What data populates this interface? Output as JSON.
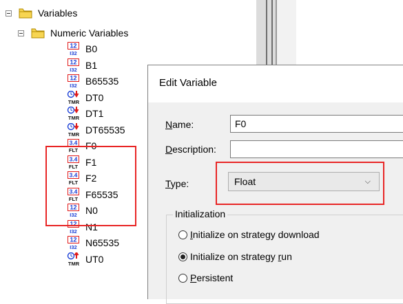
{
  "tree": {
    "root": "Variables",
    "numeric_folder": "Numeric Variables",
    "items": [
      {
        "name": "B0",
        "icon": "int32-icon"
      },
      {
        "name": "B1",
        "icon": "int32-icon"
      },
      {
        "name": "B65535",
        "icon": "int32-icon"
      },
      {
        "name": "DT0",
        "icon": "timer-down-icon"
      },
      {
        "name": "DT1",
        "icon": "timer-down-icon"
      },
      {
        "name": "DT65535",
        "icon": "timer-down-icon"
      },
      {
        "name": "F0",
        "icon": "float-icon"
      },
      {
        "name": "F1",
        "icon": "float-icon"
      },
      {
        "name": "F2",
        "icon": "float-icon"
      },
      {
        "name": "F65535",
        "icon": "float-icon"
      },
      {
        "name": "N0",
        "icon": "int32-icon"
      },
      {
        "name": "N1",
        "icon": "int32-icon"
      },
      {
        "name": "N65535",
        "icon": "int32-icon"
      },
      {
        "name": "UT0",
        "icon": "timer-up-icon"
      }
    ]
  },
  "icon_text": {
    "int_top": "12",
    "int_bottom": "I32",
    "float_top": "3.4",
    "float_bottom": "FLT",
    "timer_bottom": "TMR"
  },
  "dialog": {
    "title": "Edit Variable",
    "name_label_u": "N",
    "name_label_rest": "ame:",
    "name_value": "F0",
    "description_label_u": "D",
    "description_label_rest": "escription:",
    "description_value": "",
    "type_label_u": "T",
    "type_label_rest": "ype:",
    "type_value": "Float",
    "init_group_label": "Initialization",
    "radios": [
      {
        "pre": "",
        "u": "I",
        "post": "nitialize on strategy download",
        "checked": false
      },
      {
        "pre": "Initialize on strategy ",
        "u": "r",
        "post": "un",
        "checked": true
      },
      {
        "pre": "",
        "u": "P",
        "post": "ersistent",
        "checked": false
      }
    ]
  },
  "colors": {
    "highlight": "#e82424",
    "icon_blue": "#1a3fd6",
    "icon_red": "#e01b1b",
    "folder": "#f2c200"
  }
}
